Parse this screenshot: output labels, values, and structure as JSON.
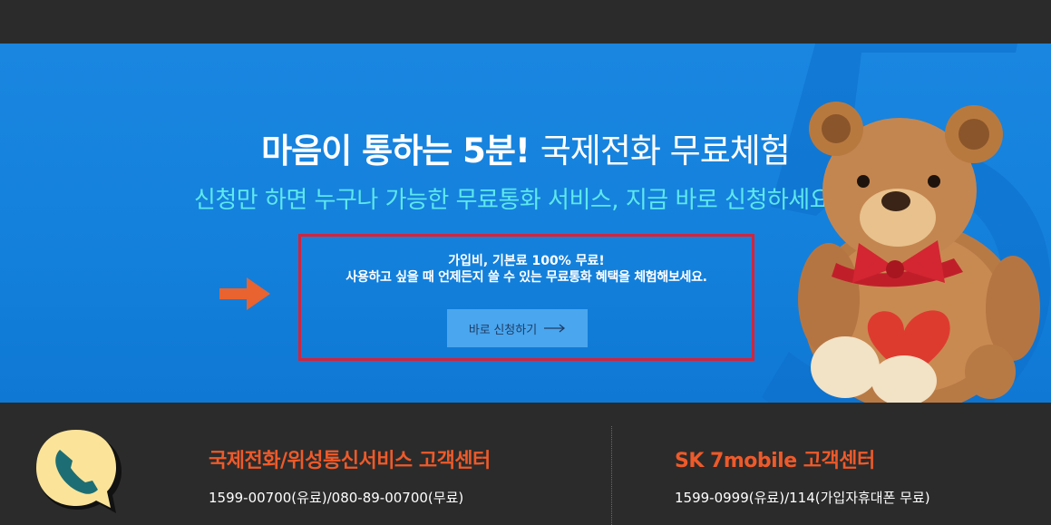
{
  "hero": {
    "title_bold": "마음이 통하는 5분!",
    "title_light": "국제전화 무료체험",
    "subtitle": "신청만 하면 누구나 가능한 무료통화 서비스, 지금 바로 신청하세요!",
    "promo_line1": "가입비, 기본료 100% 무료!",
    "promo_line2": "사용하고 싶을 때 언제든지 쓸 수 있는 무료통화 혜택을 체험해보세요.",
    "apply_button_label": "바로 신청하기",
    "colors": {
      "background": "#1380dc",
      "subtitle": "#5ee8ec",
      "highlight_border": "#d4243b",
      "arrow": "#e8632f"
    }
  },
  "footer": {
    "cs_intl": {
      "title": "국제전화/위성통신서비스 고객센터",
      "phone": "1599-00700(유료)/080-89-00700(무료)"
    },
    "cs_mobile": {
      "title": "SK 7mobile 고객센터",
      "phone": "1599-0999(유료)/114(가입자휴대폰 무료)"
    },
    "icon": "phone-bubble-icon",
    "colors": {
      "title": "#ee5a2a",
      "text": "#ffffff"
    }
  }
}
